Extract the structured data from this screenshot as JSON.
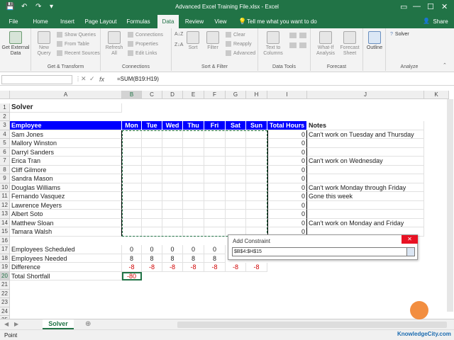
{
  "window": {
    "title": "Advanced Excel Training File.xlsx - Excel",
    "quick_access": [
      "💾",
      "↶",
      "↷",
      "▾"
    ],
    "controls": [
      "▭",
      "—",
      "☐",
      "✕"
    ]
  },
  "tabs": [
    "File",
    "Home",
    "Insert",
    "Page Layout",
    "Formulas",
    "Data",
    "Review",
    "View"
  ],
  "tell_me": "Tell me what you want to do",
  "share": "Share",
  "ribbon": {
    "get_external": "Get External Data",
    "new_query": "New Query",
    "show_queries": "Show Queries",
    "from_table": "From Table",
    "recent_sources": "Recent Sources",
    "get_transform": "Get & Transform",
    "refresh_all": "Refresh All",
    "connections": "Connections",
    "properties": "Properties",
    "edit_links": "Edit Links",
    "connections_group": "Connections",
    "sort_az": "A↓Z",
    "sort_za": "Z↓A",
    "sort": "Sort",
    "filter": "Filter",
    "clear": "Clear",
    "reapply": "Reapply",
    "advanced": "Advanced",
    "sort_filter": "Sort & Filter",
    "text_to_columns": "Text to Columns",
    "data_tools": "Data Tools",
    "what_if": "What-If Analysis",
    "forecast_sheet": "Forecast Sheet",
    "forecast": "Forecast",
    "outline": "Outline",
    "solver": "Solver",
    "analyze": "Analyze"
  },
  "formula_bar": {
    "fx": "fx",
    "formula": "=SUM(B19:H19)"
  },
  "columns": [
    "A",
    "B",
    "C",
    "D",
    "E",
    "F",
    "G",
    "H",
    "I",
    "J",
    "K"
  ],
  "rows": [
    "1",
    "2",
    "3",
    "4",
    "5",
    "6",
    "7",
    "8",
    "9",
    "10",
    "11",
    "12",
    "13",
    "14",
    "15",
    "16",
    "17",
    "18",
    "19",
    "20",
    "21",
    "22",
    "23",
    "24",
    "25"
  ],
  "sheet": {
    "title": "Solver",
    "headers": [
      "Employee",
      "Mon",
      "Tue",
      "Wed",
      "Thu",
      "Fri",
      "Sat",
      "Sun",
      "Total Hours",
      "Notes"
    ],
    "employees": [
      "Sam Jones",
      "Mallory Winston",
      "Darryl Sanders",
      "Erica Tran",
      "Cliff Gilmore",
      "Sandra Mason",
      "Douglas Williams",
      "Fernando Vasquez",
      "Lawrence Meyers",
      "Albert Soto",
      "Matthew Sloan",
      "Tamara Walsh"
    ],
    "totals": [
      "0",
      "0",
      "0",
      "0",
      "0",
      "0",
      "0",
      "0",
      "0",
      "0",
      "0",
      "0"
    ],
    "notes": [
      "Can't work on Tuesday and Thursday",
      "",
      "",
      "Can't work on Wednesday",
      "",
      "",
      "Can't work Monday through Friday",
      "Gone this week",
      "",
      "",
      "Can't work on Monday and Friday",
      ""
    ],
    "scheduled_label": "Employees Scheduled",
    "scheduled": [
      "0",
      "0",
      "0",
      "0",
      "0"
    ],
    "needed_label": "Employees Needed",
    "needed": [
      "8",
      "8",
      "8",
      "8",
      "8"
    ],
    "difference_label": "Difference",
    "difference": [
      "-8",
      "-8",
      "-8",
      "-8",
      "-8",
      "-8",
      "-8"
    ],
    "shortfall_label": "Total Shortfall",
    "shortfall": "-80"
  },
  "dialog": {
    "title": "Add Constraint",
    "value": "$B$4:$H$15"
  },
  "sheet_tab": "Solver",
  "status": "Point",
  "watermark": "KnowledgeCity.com"
}
